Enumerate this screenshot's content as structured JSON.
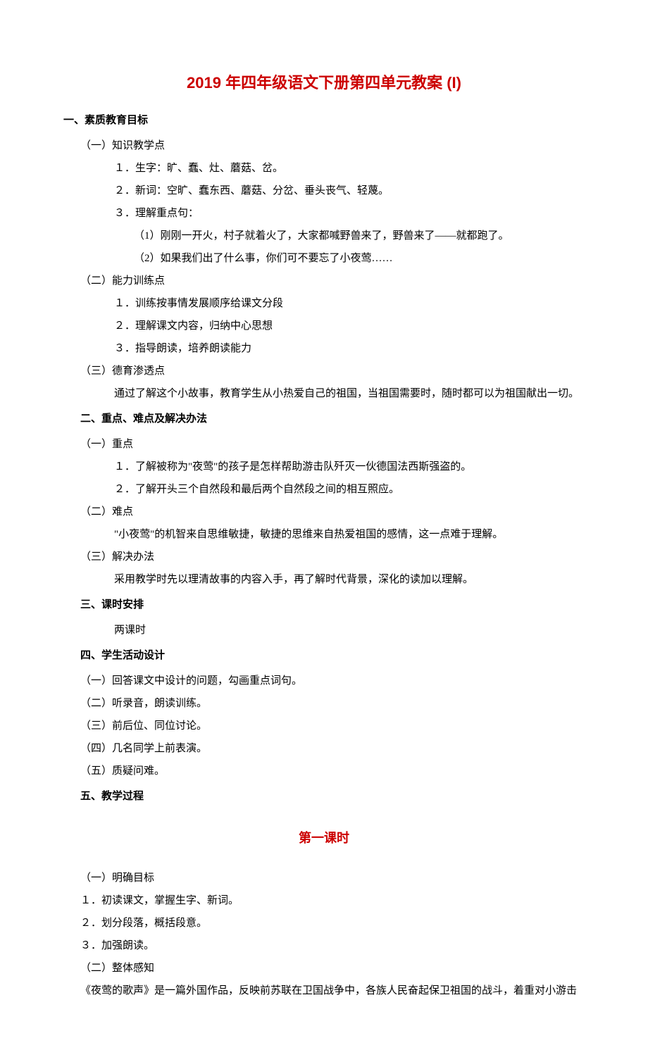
{
  "title": "2019 年四年级语文下册第四单元教案 (I)",
  "sec1": {
    "h": "一、素质教育目标",
    "s1": {
      "h": "（一）知识教学点",
      "i1": "１．生字：旷、蠢、灶、蘑菇、岔。",
      "i2": "２．新词：空旷、蠢东西、蘑菇、分岔、垂头丧气、轻蔑。",
      "i3": "３．理解重点句：",
      "i3a": "（1）刚刚一开火，村子就着火了，大家都喊野兽来了，野兽来了——就都跑了。",
      "i3b": "（2）如果我们出了什么事，你们可不要忘了小夜莺……"
    },
    "s2": {
      "h": "（二）能力训练点",
      "i1": "１．训练按事情发展顺序给课文分段",
      "i2": "２．理解课文内容，归纳中心思想",
      "i3": "３．指导朗读，培养朗读能力"
    },
    "s3": {
      "h": "（三）德育渗透点",
      "t": "通过了解这个小故事，教育学生从小热爱自己的祖国，当祖国需要时，随时都可以为祖国献出一切。"
    }
  },
  "sec2": {
    "h": "二、重点、难点及解决办法",
    "s1": {
      "h": "（一）重点",
      "i1": "１．了解被称为\"夜莺\"的孩子是怎样帮助游击队歼灭一伙德国法西斯强盗的。",
      "i2": "２．了解开头三个自然段和最后两个自然段之间的相互照应。"
    },
    "s2": {
      "h": "（二）难点",
      "t": "\"小夜莺\"的机智来自思维敏捷，敏捷的思维来自热爱祖国的感情，这一点难于理解。"
    },
    "s3": {
      "h": "（三）解决办法",
      "t": "采用教学时先以理清故事的内容入手，再了解时代背景，深化的读加以理解。"
    }
  },
  "sec3": {
    "h": "三、课时安排",
    "t": "两课时"
  },
  "sec4": {
    "h": "四、学生活动设计",
    "i1": "（一）回答课文中设计的问题，勾画重点词句。",
    "i2": "（二）听录音，朗读训练。",
    "i3": "（三）前后位、同位讨论。",
    "i4": "（四）几名同学上前表演。",
    "i5": "（五）质疑问难。"
  },
  "sec5": {
    "h": "五、教学过程"
  },
  "lesson": {
    "title": "第一课时",
    "s1": {
      "h": "（一）明确目标",
      "i1": "１．初读课文，掌握生字、新词。",
      "i2": "２．划分段落，概括段意。",
      "i3": "３．加强朗读。"
    },
    "s2": {
      "h": "（二）整体感知",
      "t": "《夜莺的歌声》是一篇外国作品，反映前苏联在卫国战争中，各族人民奋起保卫祖国的战斗，着重对小游击"
    }
  }
}
